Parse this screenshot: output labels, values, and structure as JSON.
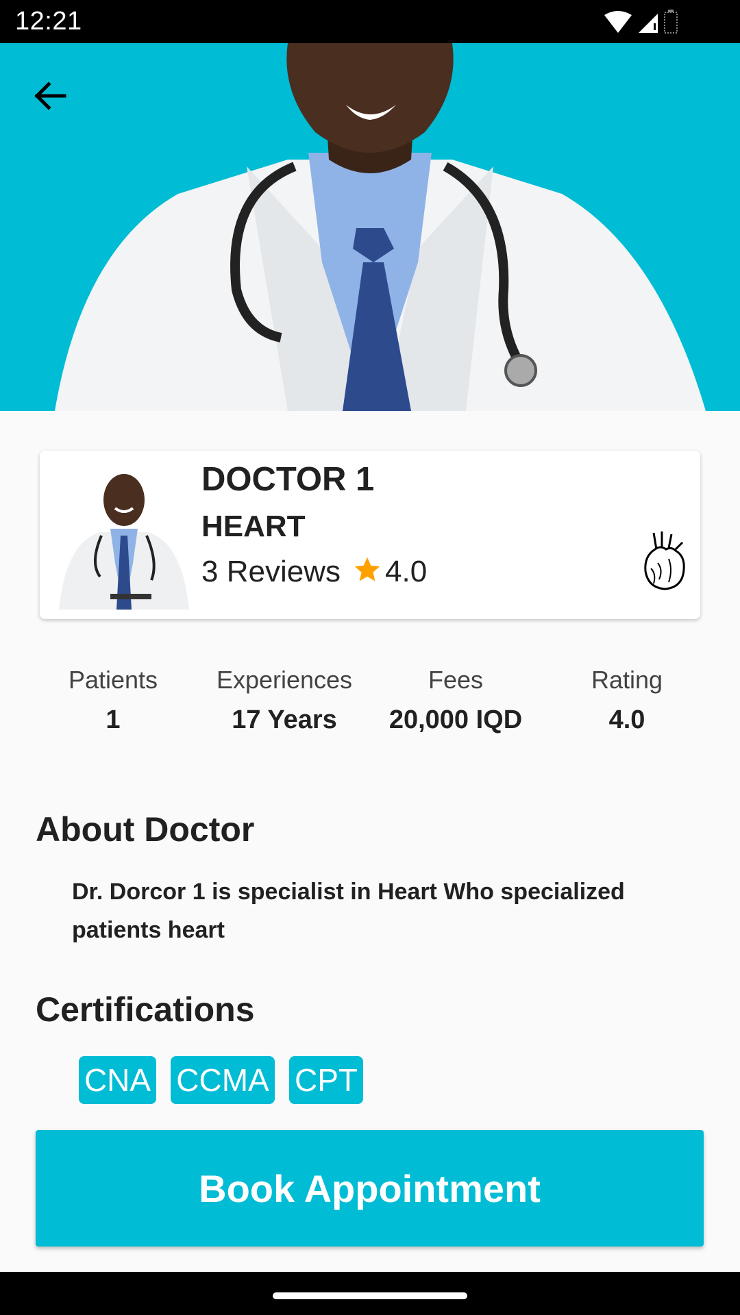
{
  "status_bar": {
    "time": "12:21"
  },
  "doctor": {
    "name": "DOCTOR 1",
    "specialty": "HEART",
    "reviews": "3 Reviews",
    "rating": "4.0"
  },
  "stats": [
    {
      "label": "Patients",
      "value": "1"
    },
    {
      "label": "Experiences",
      "value": "17 Years"
    },
    {
      "label": "Fees",
      "value": "20,000 IQD"
    },
    {
      "label": "Rating",
      "value": "4.0"
    }
  ],
  "about": {
    "title": "About Doctor",
    "text": "Dr. Dorcor 1 is specialist in Heart Who specialized patients heart"
  },
  "certifications": {
    "title": "Certifications",
    "items": [
      "CNA",
      "CCMA",
      "CPT"
    ]
  },
  "book_button": {
    "label": "Book Appointment"
  },
  "colors": {
    "accent": "#00bcd4",
    "star": "#ffa000"
  },
  "icons": [
    "back-arrow-icon",
    "wifi-icon",
    "signal-icon",
    "battery-icon",
    "star-icon",
    "heart-organ-icon"
  ]
}
